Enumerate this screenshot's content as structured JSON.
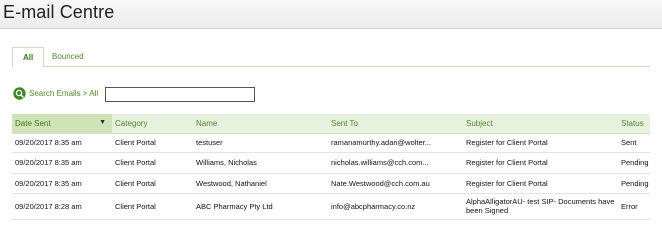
{
  "page": {
    "title": "E-mail Centre"
  },
  "tabs": [
    {
      "label": "All"
    },
    {
      "label": "Bounced"
    }
  ],
  "search": {
    "link": "Search Emails",
    "separator": " > ",
    "scope": "All",
    "value": "",
    "icon": "search-icon"
  },
  "table": {
    "columns": [
      "Date Sent",
      "Category",
      "Name",
      "Sent To",
      "Subject",
      "Status"
    ],
    "sort_indicator": "▼",
    "rows": [
      [
        "09/20/2017 8:35 am",
        "Client Portal",
        "testuser",
        "ramanamurthy.adari@wolter...",
        "Register for Client Portal",
        "Sent"
      ],
      [
        "09/20/2017 8:35 am",
        "Client Portal",
        "Williams, Nicholas",
        "nicholas.williams@cch.com...",
        "Register for Client Portal",
        "Pending"
      ],
      [
        "09/20/2017 8:35 am",
        "Client Portal",
        "Westwood, Nathaniel",
        "Nate.Westwood@cch.com.au",
        "Register for Client Portal",
        "Pending"
      ],
      [
        "09/20/2017 8:28 am",
        "Client Portal",
        "ABC Pharmacy Pty Ltd",
        "info@abcpharmacy.co.nz",
        "AlphaAlligatorAU- test SIP- Documents have been Signed",
        "Error"
      ]
    ]
  },
  "colors": {
    "accent": "#4f8a2a",
    "header_bg": "#e8f1de",
    "sorted_bg": "#cfe3b8"
  }
}
